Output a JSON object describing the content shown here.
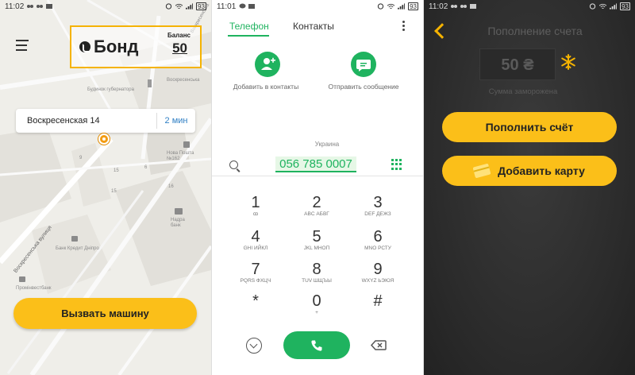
{
  "screen_left": {
    "status": {
      "time": "11:02",
      "battery": "93"
    },
    "brand": {
      "name": "Бонд",
      "balance_label": "Баланс",
      "balance_value": "50"
    },
    "address": {
      "text": "Воскресенская 14",
      "eta": "2 мин"
    },
    "call_button": "Вызвать машину",
    "map_labels": {
      "governor": "Будинок губернатора",
      "nova_poshta": "Нова Пошта №162",
      "nadra": "Надра банк",
      "kredit": "Банк Кредит Днiпро",
      "prominvest": "Промiнвестбанк",
      "street": "Воскресенська вулиця",
      "street_top": "Воскресенська",
      "street_right": "Воскресенська",
      "num_9": "9",
      "num_15": "15",
      "num_16": "16",
      "num_15b": "15",
      "num_6": "6"
    }
  },
  "screen_middle": {
    "status": {
      "time": "11:01",
      "battery": "93"
    },
    "tabs": [
      {
        "label": "Телефон"
      },
      {
        "label": "Контакты"
      }
    ],
    "actions": {
      "add_contact": "Добавить в контакты",
      "send_message": "Отправить сообщение"
    },
    "country": "Украина",
    "number": "056 785 0007",
    "keys": [
      {
        "digit": "1",
        "letters": "ꝏ"
      },
      {
        "digit": "2",
        "letters": "ABC АБВГ"
      },
      {
        "digit": "3",
        "letters": "DEF ДЕЖЗ"
      },
      {
        "digit": "4",
        "letters": "GHI ИЙКЛ"
      },
      {
        "digit": "5",
        "letters": "JKL МНОП"
      },
      {
        "digit": "6",
        "letters": "MNO РСТУ"
      },
      {
        "digit": "7",
        "letters": "PQRS ФХЦЧ"
      },
      {
        "digit": "8",
        "letters": "TUV ШЩЪЫ"
      },
      {
        "digit": "9",
        "letters": "WXYZ ЬЭЮЯ"
      },
      {
        "digit": "*",
        "letters": ""
      },
      {
        "digit": "0",
        "letters": "+"
      },
      {
        "digit": "#",
        "letters": ""
      }
    ]
  },
  "screen_right": {
    "status": {
      "time": "11:02",
      "battery": "93"
    },
    "title": "Пополнение счета",
    "amount": "50 ₴",
    "frozen_label": "Сумма заморожена",
    "topup_button": "Пополнить счёт",
    "add_card_button": "Добавить карту"
  },
  "colors": {
    "accent_yellow": "#fbbf19",
    "dialer_green": "#1fb35f",
    "eta_blue": "#2f7fc4"
  }
}
